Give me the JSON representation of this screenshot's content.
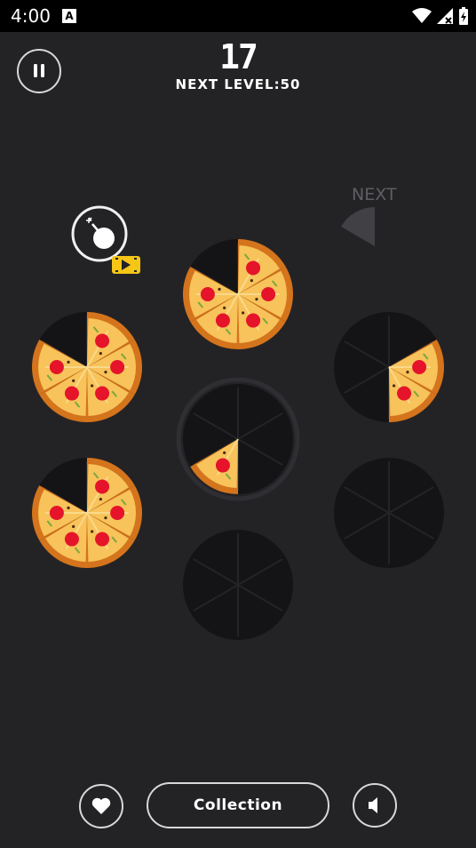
{
  "status_bar": {
    "time": "4:00",
    "notification_icon": "A"
  },
  "game": {
    "score": "17",
    "next_level_text": "NEXT LEVEL:50",
    "next_label": "NEXT"
  },
  "controls": {
    "collection_label": "Collection",
    "pause_icon": "pause-icon",
    "bomb_icon": "bomb-icon",
    "video_badge_icon": "video-ad-icon",
    "heart_icon": "heart-icon",
    "sound_icon": "speaker-icon"
  },
  "board": {
    "plates": [
      {
        "name": "plate-top-center",
        "slices": [
          0,
          1,
          2,
          3,
          4
        ]
      },
      {
        "name": "plate-left-upper",
        "slices": [
          0,
          1,
          2,
          3,
          4
        ]
      },
      {
        "name": "plate-right-upper",
        "slices": [
          1,
          2
        ]
      },
      {
        "name": "plate-center",
        "slices": [
          3
        ]
      },
      {
        "name": "plate-left-lower",
        "slices": [
          0,
          1,
          2,
          3,
          4
        ]
      },
      {
        "name": "plate-right-lower",
        "slices": []
      },
      {
        "name": "plate-bottom-center",
        "slices": []
      }
    ],
    "next_piece_slices": 1
  },
  "colors": {
    "background": "#232326",
    "crust": "#d4741c",
    "cheese": "#f7c35a",
    "pepperoni": "#e5142a",
    "plate": "#141416",
    "badge": "#f5c518"
  }
}
